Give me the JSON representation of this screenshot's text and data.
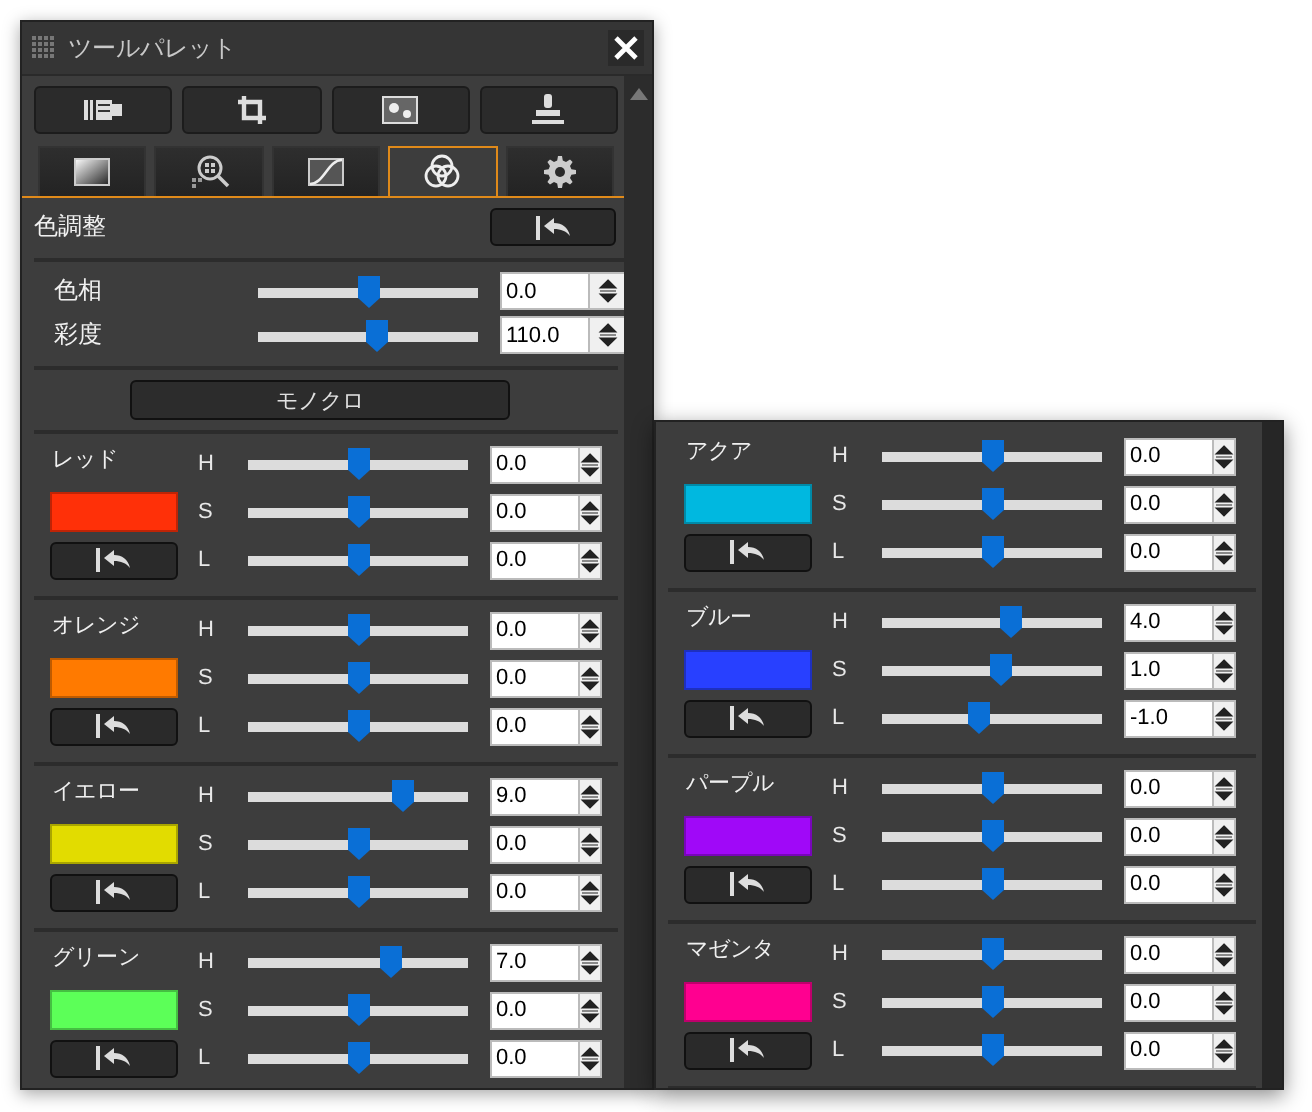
{
  "window": {
    "title": "ツールパレット"
  },
  "toolbar": [
    {
      "kind": "levels"
    },
    {
      "kind": "crop"
    },
    {
      "kind": "dust"
    },
    {
      "kind": "stamp"
    }
  ],
  "tabs": [
    {
      "kind": "gradation",
      "selected": false
    },
    {
      "kind": "zoom",
      "selected": false
    },
    {
      "kind": "curve",
      "selected": false
    },
    {
      "kind": "color",
      "selected": true
    },
    {
      "kind": "gear",
      "selected": false
    }
  ],
  "section": {
    "title": "色調整"
  },
  "adjust": [
    {
      "label": "色相",
      "level": 0.5,
      "value": "0.0"
    },
    {
      "label": "彩度",
      "level": 0.545,
      "value": "110.0"
    }
  ],
  "monochrome_button": "モノクロ",
  "colors_left": [
    {
      "name": "レッド",
      "color": "#ff3008",
      "channels": [
        {
          "label": "H",
          "level": 0.5,
          "value": "0.0"
        },
        {
          "label": "S",
          "level": 0.5,
          "value": "0.0"
        },
        {
          "label": "L",
          "level": 0.5,
          "value": "0.0"
        }
      ]
    },
    {
      "name": "オレンジ",
      "color": "#ff7a00",
      "channels": [
        {
          "label": "H",
          "level": 0.5,
          "value": "0.0"
        },
        {
          "label": "S",
          "level": 0.5,
          "value": "0.0"
        },
        {
          "label": "L",
          "level": 0.5,
          "value": "0.0"
        }
      ]
    },
    {
      "name": "イエロー",
      "color": "#e2dc00",
      "channels": [
        {
          "label": "H",
          "level": 0.7,
          "value": "9.0"
        },
        {
          "label": "S",
          "level": 0.5,
          "value": "0.0"
        },
        {
          "label": "L",
          "level": 0.5,
          "value": "0.0"
        }
      ]
    },
    {
      "name": "グリーン",
      "color": "#5cff58",
      "channels": [
        {
          "label": "H",
          "level": 0.65,
          "value": "7.0"
        },
        {
          "label": "S",
          "level": 0.5,
          "value": "0.0"
        },
        {
          "label": "L",
          "level": 0.5,
          "value": "0.0"
        }
      ]
    }
  ],
  "colors_right": [
    {
      "name": "アクア",
      "color": "#00b8e0",
      "channels": [
        {
          "label": "H",
          "level": 0.5,
          "value": "0.0"
        },
        {
          "label": "S",
          "level": 0.5,
          "value": "0.0"
        },
        {
          "label": "L",
          "level": 0.5,
          "value": "0.0"
        }
      ]
    },
    {
      "name": "ブルー",
      "color": "#2840ff",
      "channels": [
        {
          "label": "H",
          "level": 0.59,
          "value": "4.0"
        },
        {
          "label": "S",
          "level": 0.545,
          "value": "1.0"
        },
        {
          "label": "L",
          "level": 0.445,
          "value": "-1.0"
        }
      ]
    },
    {
      "name": "パープル",
      "color": "#a008f8",
      "channels": [
        {
          "label": "H",
          "level": 0.5,
          "value": "0.0"
        },
        {
          "label": "S",
          "level": 0.5,
          "value": "0.0"
        },
        {
          "label": "L",
          "level": 0.5,
          "value": "0.0"
        }
      ]
    },
    {
      "name": "マゼンタ",
      "color": "#ff0090",
      "channels": [
        {
          "label": "H",
          "level": 0.5,
          "value": "0.0"
        },
        {
          "label": "S",
          "level": 0.5,
          "value": "0.0"
        },
        {
          "label": "L",
          "level": 0.5,
          "value": "0.0"
        }
      ]
    }
  ]
}
